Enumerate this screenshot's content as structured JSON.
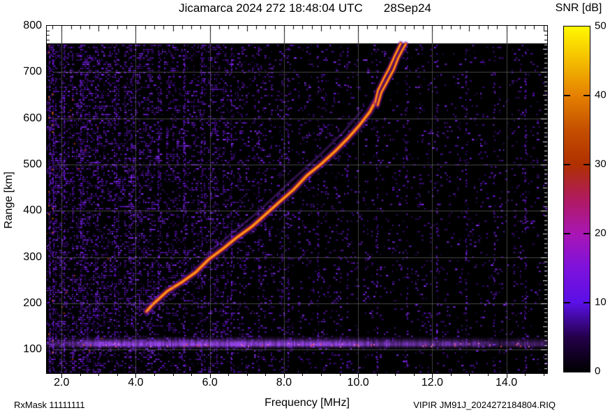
{
  "header": {
    "title": "Jicamarca 2024 272 18:48:04 UTC",
    "date": "28Sep24"
  },
  "footer": {
    "rx_mask": "RxMask 11111111",
    "xlabel": "Frequency [MHz]",
    "file_id": "VIPIR  JM91J_2024272184804.RIQ"
  },
  "chart_data": {
    "type": "heatmap",
    "title": "Jicamarca 2024 272 18:48:04 UTC",
    "date_label": "28Sep24",
    "xlabel": "Frequency [MHz]",
    "ylabel": "Range [km]",
    "xlim": [
      1.6,
      15.1
    ],
    "ylim": [
      49,
      800
    ],
    "x_ticks": [
      2.0,
      4.0,
      6.0,
      8.0,
      10.0,
      12.0,
      14.0
    ],
    "y_ticks": [
      100,
      200,
      300,
      400,
      500,
      600,
      700,
      800
    ],
    "grid": true,
    "data_max_range_km": 762,
    "colorbar": {
      "label": "SNR [dB]",
      "min": 0,
      "max": 50,
      "ticks": [
        0,
        10,
        20,
        30,
        40,
        50
      ],
      "palette_bottom_to_top": [
        "#000000",
        "#24004a",
        "#5a10e6",
        "#7d12dc",
        "#a916b4",
        "#b01a60",
        "#b03000",
        "#c44f00",
        "#e58000",
        "#f4bc00",
        "#fff800"
      ]
    },
    "echo_trace": {
      "description": "oblique F-layer echo trace, SNR ~35-45 dB core",
      "main_points_mhz_km": [
        [
          4.3,
          182
        ],
        [
          4.44,
          197
        ],
        [
          4.86,
          226
        ],
        [
          5.23,
          245
        ],
        [
          5.61,
          268
        ],
        [
          5.99,
          295
        ],
        [
          6.36,
          319
        ],
        [
          6.74,
          343
        ],
        [
          7.12,
          366
        ],
        [
          7.49,
          391
        ],
        [
          7.87,
          419
        ],
        [
          8.25,
          446
        ],
        [
          8.62,
          476
        ],
        [
          9.0,
          501
        ],
        [
          9.38,
          529
        ],
        [
          9.75,
          559
        ],
        [
          10.03,
          584
        ],
        [
          10.32,
          615
        ],
        [
          10.45,
          634
        ]
      ],
      "branch_o_points": [
        [
          10.45,
          634
        ],
        [
          10.54,
          660
        ],
        [
          10.69,
          684
        ],
        [
          10.84,
          710
        ],
        [
          10.97,
          732
        ],
        [
          11.07,
          750
        ],
        [
          11.14,
          762
        ]
      ],
      "branch_x_points": [
        [
          10.52,
          629
        ],
        [
          10.63,
          655
        ],
        [
          10.79,
          679
        ],
        [
          10.96,
          705
        ],
        [
          11.09,
          729
        ],
        [
          11.2,
          747
        ],
        [
          11.28,
          760
        ]
      ],
      "x_mode_faint_points": [
        [
          5.9,
          305
        ],
        [
          6.6,
          352
        ],
        [
          7.35,
          402
        ],
        [
          8.1,
          457
        ],
        [
          8.85,
          512
        ],
        [
          9.6,
          570
        ],
        [
          10.05,
          612
        ]
      ],
      "colors": {
        "glow": "rgba(118,30,210,0.38)",
        "outer": "rgba(186,40,25,0.92)",
        "core": "#ea6c0e",
        "bright": "#ffa428",
        "faint": "rgba(140,55,225,0.30)"
      }
    },
    "e_region_band": {
      "center_km": 112,
      "half_width_km": 9,
      "core_color": "#a64dff",
      "speck_colors": [
        "#ff79c0",
        "#ff4a3c"
      ],
      "intensity_profile": [
        [
          1.6,
          0.45
        ],
        [
          2.4,
          0.62
        ],
        [
          3.1,
          0.95
        ],
        [
          5.0,
          1.0
        ],
        [
          9.2,
          1.0
        ],
        [
          10.3,
          0.8
        ],
        [
          12.0,
          0.72
        ],
        [
          13.3,
          0.62
        ],
        [
          13.8,
          0.28
        ],
        [
          14.3,
          0.55
        ],
        [
          15.1,
          0.5
        ]
      ]
    },
    "background_noise": {
      "description": "purple speckle noise, denser below 6.5 MHz, vertical striping",
      "palette": [
        "#7c22f0",
        "#5a10b8",
        "#6a14d8",
        "#3c0a78",
        "#8c30ff"
      ],
      "red_speck_color": "#c03010",
      "density_by_band": [
        [
          1.6,
          3.0,
          0.42
        ],
        [
          3.0,
          4.5,
          0.34
        ],
        [
          4.5,
          6.5,
          0.27
        ],
        [
          6.5,
          8.0,
          0.17
        ],
        [
          8.0,
          10.0,
          0.11
        ],
        [
          10.0,
          15.1,
          0.075
        ]
      ]
    },
    "rfi_columns": [
      {
        "f": 1.66,
        "s": 1.6,
        "hot": true
      },
      {
        "f": 1.76,
        "s": 1.2,
        "hot": true
      },
      {
        "f": 2.06,
        "s": 0.9
      },
      {
        "f": 2.5,
        "s": 0.8
      },
      {
        "f": 2.96,
        "s": 0.9
      },
      {
        "f": 3.42,
        "s": 0.8
      },
      {
        "f": 3.86,
        "s": 0.7
      },
      {
        "f": 4.6,
        "s": 0.8
      },
      {
        "f": 5.3,
        "s": 0.7
      },
      {
        "f": 5.76,
        "s": 0.6
      },
      {
        "f": 6.56,
        "s": 0.7
      },
      {
        "f": 7.3,
        "s": 0.5
      },
      {
        "f": 8.1,
        "s": 0.5
      },
      {
        "f": 8.9,
        "s": 0.45
      },
      {
        "f": 9.7,
        "s": 0.4
      },
      {
        "f": 10.5,
        "s": 0.45
      },
      {
        "f": 11.3,
        "s": 0.4
      },
      {
        "f": 12.12,
        "s": 0.5
      },
      {
        "f": 12.9,
        "s": 0.45
      },
      {
        "f": 13.66,
        "s": 0.5
      },
      {
        "f": 14.5,
        "s": 0.55
      }
    ]
  }
}
